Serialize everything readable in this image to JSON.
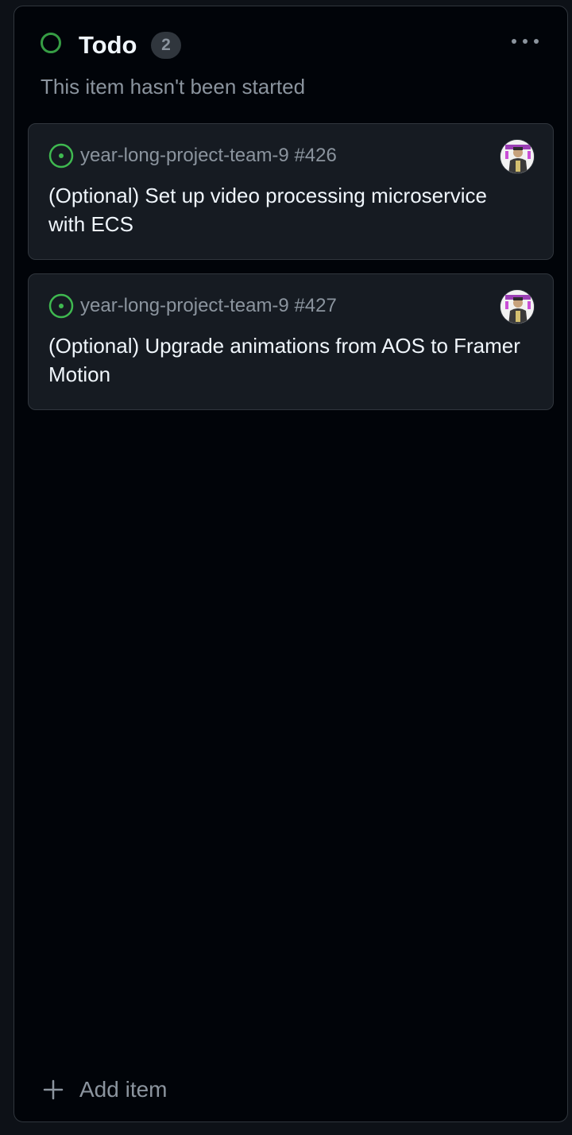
{
  "column": {
    "title": "Todo",
    "count": "2",
    "description": "This item hasn't been started",
    "status_color": "#3fb950",
    "more_icon": "kebab-horizontal-icon"
  },
  "cards": [
    {
      "repo": "year-long-project-team-9 #426",
      "title": "(Optional) Set up video processing microservice with ECS",
      "status_icon": "issue-opened-icon",
      "status_color": "#3fb950"
    },
    {
      "repo": "year-long-project-team-9 #427",
      "title": "(Optional) Upgrade animations from AOS to Framer Motion",
      "status_icon": "issue-opened-icon",
      "status_color": "#3fb950"
    }
  ],
  "footer": {
    "add_label": "Add item",
    "add_icon": "plus-icon"
  },
  "theme": {
    "background": "#010409",
    "card_background": "#161b22",
    "border": "#30363d",
    "text_primary": "#f0f6fc",
    "text_muted": "#8b949e"
  }
}
